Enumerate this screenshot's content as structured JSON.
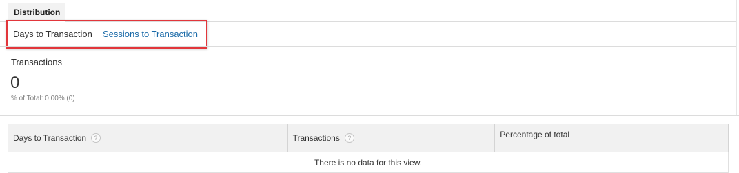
{
  "tab": {
    "label": "Distribution"
  },
  "subtabs": {
    "active": "Days to Transaction",
    "link": "Sessions to Transaction"
  },
  "metric": {
    "label": "Transactions",
    "value": "0",
    "sub": "% of Total: 0.00% (0)"
  },
  "table": {
    "headers": [
      "Days to Transaction",
      "Transactions",
      "Percentage of total"
    ],
    "help_glyph": "?",
    "empty_message": "There is no data for this view."
  },
  "colors": {
    "highlight": "#e2363b",
    "link": "#1a6aa8"
  }
}
